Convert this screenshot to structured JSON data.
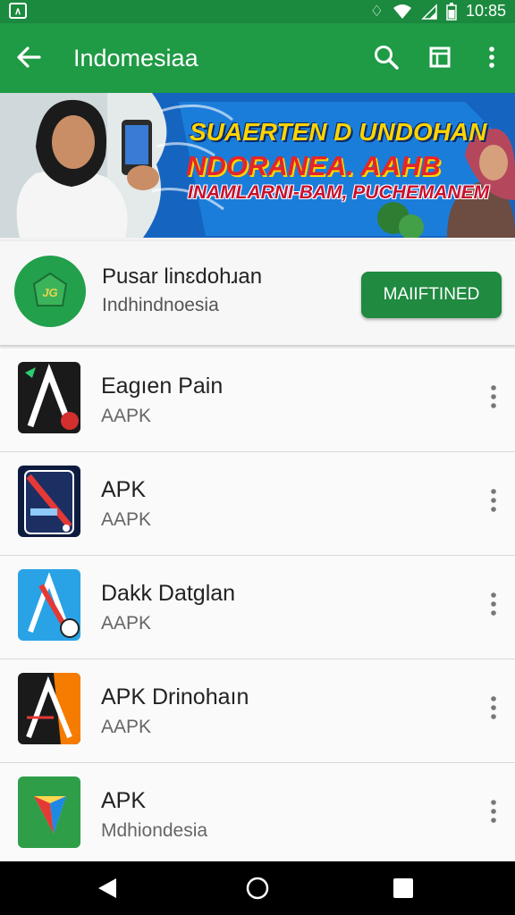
{
  "status_bar": {
    "time": "10:85"
  },
  "toolbar": {
    "title": "Indomesiaa"
  },
  "banner": {
    "line1": "SUAERTEN D UNDOHAN",
    "line2": "NDORANEA. AAHB",
    "line3": "INAMLARNI-BAM, PUCHEMANEM"
  },
  "featured": {
    "icon_text": "JG",
    "title": "Pusar linɛdohɹan",
    "subtitle": "Indhindnoesia",
    "button": "MAIIFTINED"
  },
  "apps": [
    {
      "title": "Eagıen Pain",
      "subtitle": "AAPK",
      "icon": "apk-a-icon"
    },
    {
      "title": "APK",
      "subtitle": "AAPK",
      "icon": "apk-phone-icon"
    },
    {
      "title": "Dakk Datglan",
      "subtitle": "AAPK",
      "icon": "apk-blue-a-icon"
    },
    {
      "title": "APK Drinohaın",
      "subtitle": "AAPK",
      "icon": "apk-orange-a-icon"
    },
    {
      "title": "APK",
      "subtitle": "Mdhiondesia",
      "icon": "apk-play-icon"
    }
  ],
  "colors": {
    "primary": "#1f9a45",
    "status_bar": "#1b8a3e",
    "button": "#1f8a40"
  }
}
